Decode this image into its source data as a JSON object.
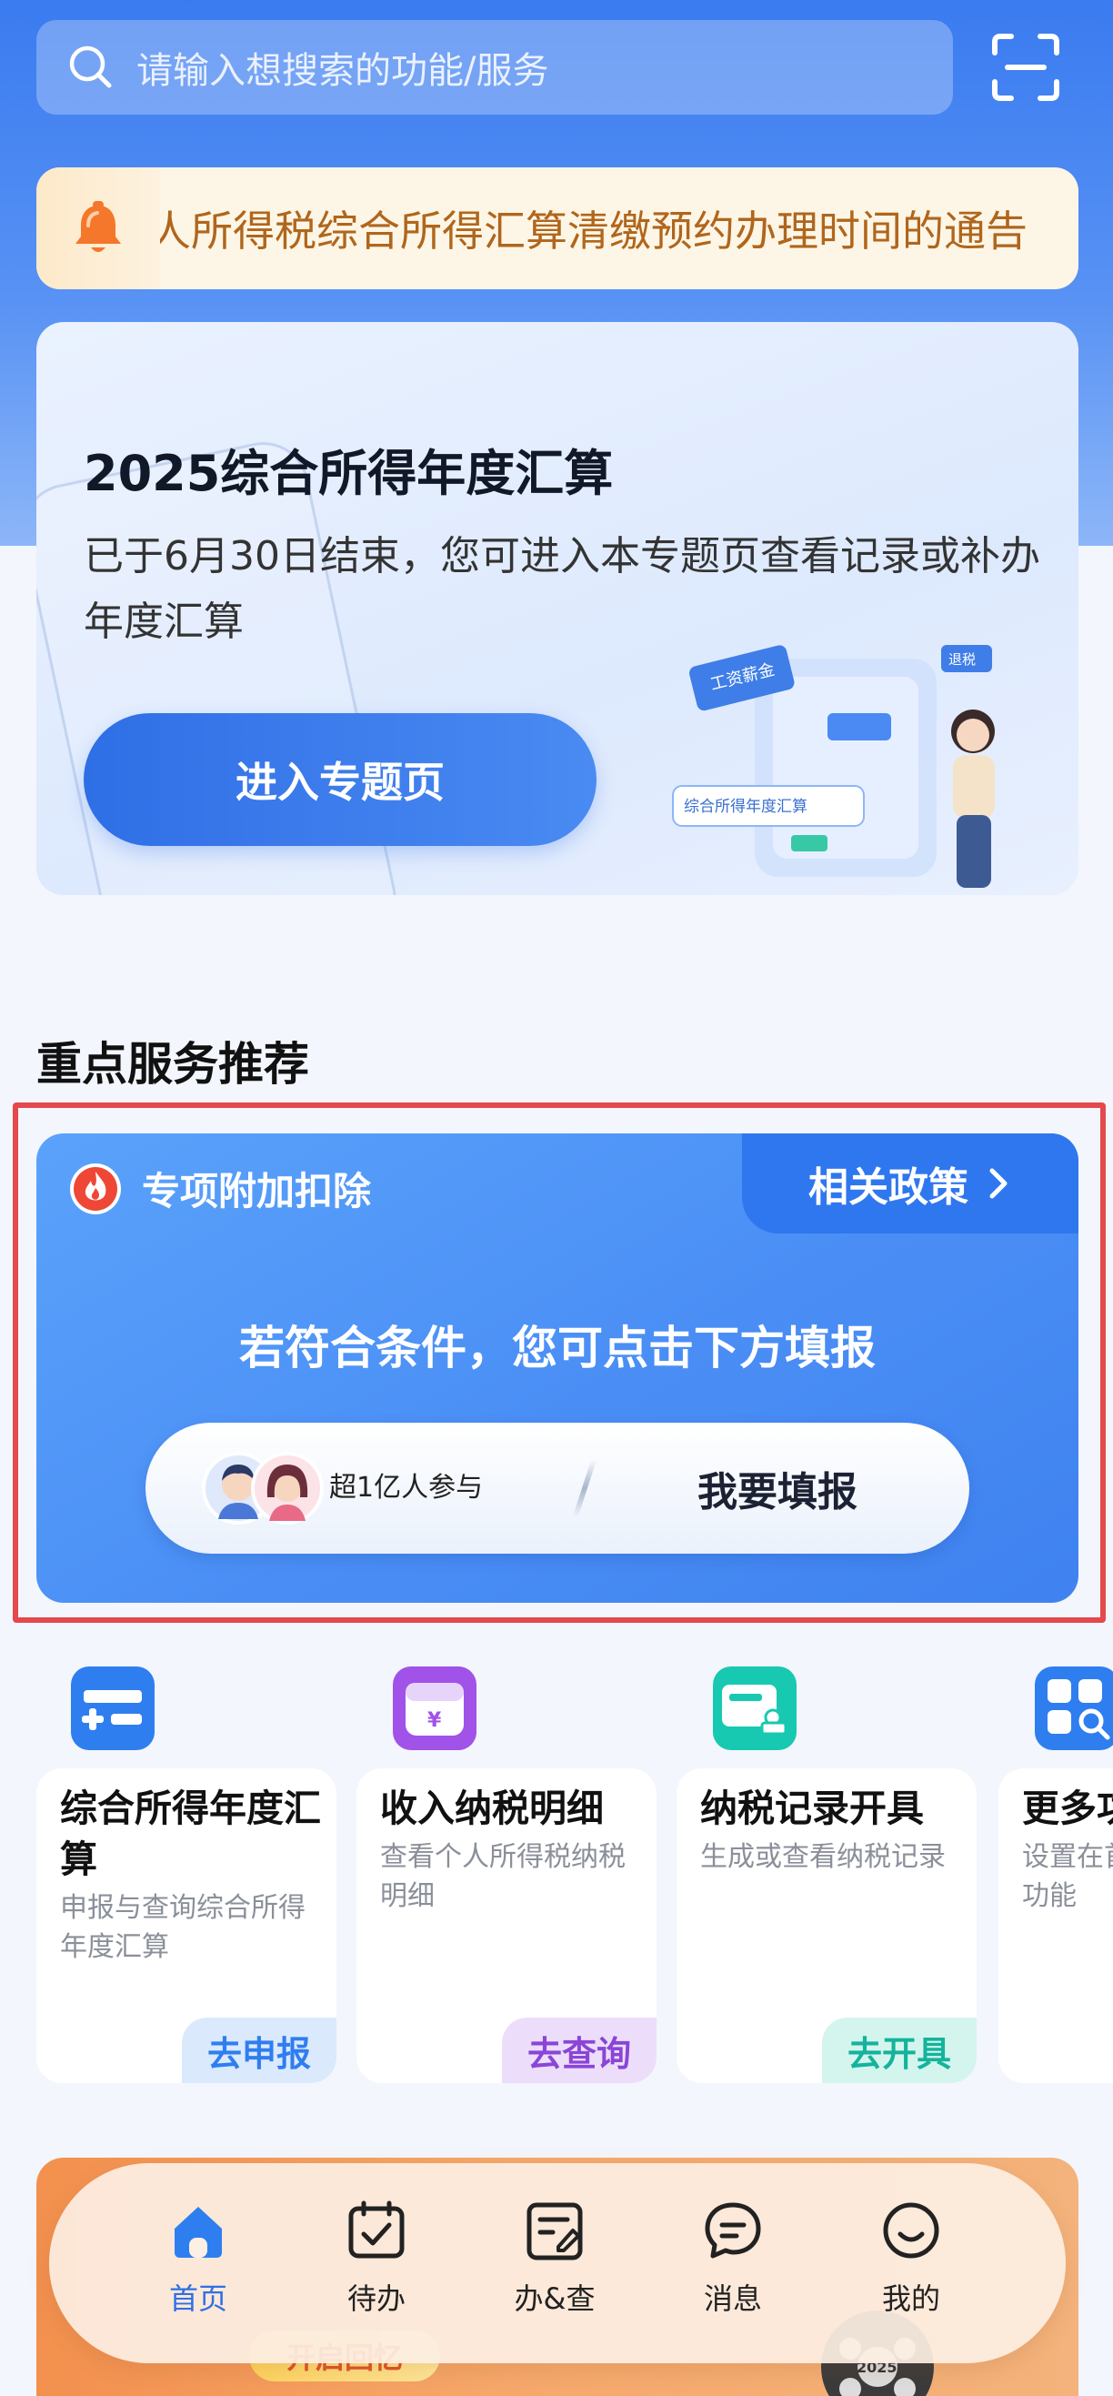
{
  "search": {
    "placeholder": "请输入想搜索的功能/服务"
  },
  "notice": {
    "text": "个人所得税综合所得汇算清缴预约办理时间的通告"
  },
  "banner": {
    "title": "2025综合所得年度汇算",
    "description": "已于6月30日结束，您可进入本专题页查看记录或补办年度汇算",
    "button": "进入专题页",
    "illustration_labels": [
      "工资薪金",
      "退税",
      "综合所得年度汇算"
    ]
  },
  "section": {
    "title": "重点服务推荐"
  },
  "deduction": {
    "title": "专项附加扣除",
    "policy_link": "相关政策",
    "prompt": "若符合条件，您可点击下方填报",
    "participants": "超1亿人参与",
    "fill_button": "我要填报"
  },
  "services": [
    {
      "title": "综合所得年度汇算",
      "desc": "申报与查询综合所得年度汇算",
      "action": "去申报",
      "color": "#2f7ef0",
      "action_bg": "#dbe9fd",
      "action_color": "#2f7ef0",
      "icon": "tax-form-icon"
    },
    {
      "title": "收入纳税明细",
      "desc": "查看个人所得税纳税明细",
      "action": "去查询",
      "color": "#a152e8",
      "action_bg": "#ecdefb",
      "action_color": "#8b45d6",
      "icon": "wallet-icon"
    },
    {
      "title": "纳税记录开具",
      "desc": "生成或查看纳税记录",
      "action": "去开具",
      "color": "#17c9b0",
      "action_bg": "#d4f5ee",
      "action_color": "#14b39c",
      "icon": "stamp-icon"
    },
    {
      "title": "更多功能",
      "desc": "设置在首页展示常用功能",
      "action": "",
      "color": "#2f7ef0",
      "action_bg": "#dbe9fd",
      "action_color": "#2f7ef0",
      "icon": "grid-search-icon"
    }
  ],
  "bottom_banner": {
    "button": "开启回忆",
    "reel_label": "2025"
  },
  "tabbar": [
    {
      "label": "首页",
      "icon": "home-icon",
      "active": true
    },
    {
      "label": "待办",
      "icon": "calendar-check-icon",
      "active": false
    },
    {
      "label": "办&查",
      "icon": "document-edit-icon",
      "active": false
    },
    {
      "label": "消息",
      "icon": "message-icon",
      "active": false
    },
    {
      "label": "我的",
      "icon": "smile-icon",
      "active": false
    }
  ],
  "colors": {
    "primary": "#2f6fe6",
    "notice_text": "#b0661c",
    "highlight": "#e5484d"
  }
}
